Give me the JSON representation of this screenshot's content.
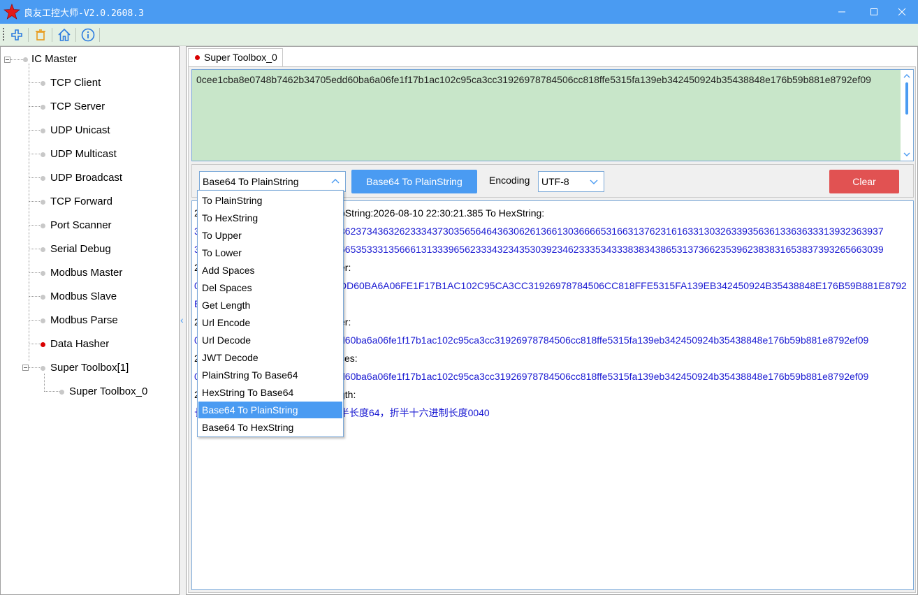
{
  "window": {
    "title": "良友工控大师-V2.0.2608.3",
    "accent_color": "#4a9bf2",
    "icons": [
      "red-star-icon",
      "minimize-icon",
      "maximize-icon",
      "close-icon"
    ]
  },
  "toolbar": {
    "icons": [
      "add-icon",
      "delete-icon",
      "home-icon",
      "info-icon"
    ]
  },
  "tree": {
    "root": "IC Master",
    "items": [
      {
        "label": "TCP Client"
      },
      {
        "label": "TCP Server"
      },
      {
        "label": "UDP Unicast"
      },
      {
        "label": "UDP Multicast"
      },
      {
        "label": "UDP Broadcast"
      },
      {
        "label": "TCP Forward"
      },
      {
        "label": "Port Scanner"
      },
      {
        "label": "Serial Debug"
      },
      {
        "label": "Modbus Master"
      },
      {
        "label": "Modbus Slave"
      },
      {
        "label": "Modbus Parse"
      },
      {
        "label": "Data Hasher"
      },
      {
        "label": "Super Toolbox[1]"
      },
      {
        "label": "Super Toolbox_0"
      }
    ]
  },
  "tab": {
    "label": "Super Toolbox_0"
  },
  "input": {
    "text": "0cee1cba8e0748b7462b34705edd60ba6a06fe1f17b1ac102c95ca3cc31926978784506cc818ffe5315fa139eb342450924b35438848e176b59b881e8792ef09"
  },
  "controls": {
    "operation_select": "Base64 To PlainString",
    "run_button": "Base64 To PlainString",
    "encoding_label": "Encoding",
    "encoding_value": "UTF-8",
    "clear_button": "Clear"
  },
  "dropdown": {
    "options": [
      "To PlainString",
      "To HexString",
      "To Upper",
      "To Lower",
      "Add Spaces",
      "Del Spaces",
      "Get Length",
      "Url Encode",
      "Url Decode",
      "JWT Decode",
      "PlainString To Base64",
      "HexString To Base64",
      "Base64 To PlainString",
      "Base64 To HexString"
    ],
    "selected_index": 12
  },
  "output": {
    "lines": [
      {
        "lead": "2",
        "text": "oString:2026-08-10 22:30:21.385 To HexString:",
        "color": "black"
      },
      {
        "lead": "3",
        "text": "8623734363262333437303565646436306261366130366665316631376231616331303263393563613363633313932363937",
        "color": "blue"
      },
      {
        "lead": "3",
        "text": "6653533313566613133396562333432343530392346233353433383834386531373662353962383831653837393265663039",
        "color": "blue"
      },
      {
        "lead": "2",
        "text": "er:",
        "color": "black"
      },
      {
        "lead": "0",
        "text": "DD60BA6A06FE1F17B1AC102C95CA3CC31926978784506CC818FFE5315FA139EB342450924B35438848E176B59B881E8792",
        "color": "blue"
      },
      {
        "lead": "E",
        "text": "",
        "color": "blue"
      },
      {
        "lead": "2",
        "text": "er:",
        "color": "black"
      },
      {
        "lead": "0",
        "text": "d60ba6a06fe1f17b1ac102c95ca3cc31926978784506cc818ffe5315fa139eb342450924b35438848e176b59b881e8792ef09",
        "color": "blue"
      },
      {
        "lead": "2",
        "text": "ces:",
        "color": "black"
      },
      {
        "lead": "0",
        "text": "d60ba6a06fe1f17b1ac102c95ca3cc31926978784506cc818ffe5315fa139eb342450924b35438848e176b59b881e8792ef09",
        "color": "blue"
      },
      {
        "lead": "2",
        "text": "gth:",
        "color": "black"
      },
      {
        "lead": "长",
        "text": "半长度64，折半十六进制长度0040",
        "color": "blue"
      }
    ]
  }
}
